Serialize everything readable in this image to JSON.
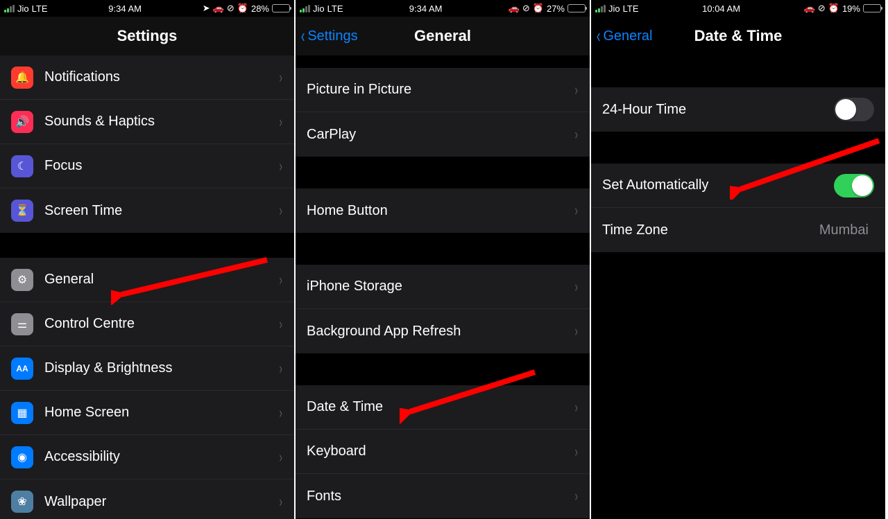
{
  "phone1": {
    "status": {
      "carrier": "Jio",
      "network": "LTE",
      "time": "9:34 AM",
      "battery_pct": "28%",
      "battery_level": 28
    },
    "nav": {
      "title": "Settings"
    },
    "group1": [
      {
        "name": "notifications",
        "label": "Notifications",
        "icon": "bell-icon",
        "icon_bg": "ic-red",
        "glyph": "🔔"
      },
      {
        "name": "sounds-haptics",
        "label": "Sounds & Haptics",
        "icon": "speaker-icon",
        "icon_bg": "ic-pink",
        "glyph": "🔊"
      },
      {
        "name": "focus",
        "label": "Focus",
        "icon": "moon-icon",
        "icon_bg": "ic-indigo",
        "glyph": "☾"
      },
      {
        "name": "screen-time",
        "label": "Screen Time",
        "icon": "hourglass-icon",
        "icon_bg": "ic-indigo",
        "glyph": "⏳"
      }
    ],
    "group2": [
      {
        "name": "general",
        "label": "General",
        "icon": "gear-icon",
        "icon_bg": "ic-gray",
        "glyph": "⚙"
      },
      {
        "name": "control-centre",
        "label": "Control Centre",
        "icon": "toggles-icon",
        "icon_bg": "ic-gray",
        "glyph": "⚌"
      },
      {
        "name": "display-brightness",
        "label": "Display & Brightness",
        "icon": "text-size-icon",
        "icon_bg": "ic-blue",
        "glyph": "AA"
      },
      {
        "name": "home-screen",
        "label": "Home Screen",
        "icon": "grid-icon",
        "icon_bg": "ic-blue",
        "glyph": "▦"
      },
      {
        "name": "accessibility",
        "label": "Accessibility",
        "icon": "person-icon",
        "icon_bg": "ic-blue",
        "glyph": "◉"
      },
      {
        "name": "wallpaper",
        "label": "Wallpaper",
        "icon": "flower-icon",
        "icon_bg": "ic-teal",
        "glyph": "❀"
      }
    ],
    "arrow_target": "general"
  },
  "phone2": {
    "status": {
      "carrier": "Jio",
      "network": "LTE",
      "time": "9:34 AM",
      "battery_pct": "27%",
      "battery_level": 27
    },
    "nav": {
      "back": "Settings",
      "title": "General"
    },
    "groups": [
      [
        {
          "name": "picture-in-picture",
          "label": "Picture in Picture"
        },
        {
          "name": "carplay",
          "label": "CarPlay"
        }
      ],
      [
        {
          "name": "home-button",
          "label": "Home Button"
        }
      ],
      [
        {
          "name": "iphone-storage",
          "label": "iPhone Storage"
        },
        {
          "name": "background-app-refresh",
          "label": "Background App Refresh"
        }
      ],
      [
        {
          "name": "date-time",
          "label": "Date & Time"
        },
        {
          "name": "keyboard",
          "label": "Keyboard"
        },
        {
          "name": "fonts",
          "label": "Fonts"
        }
      ]
    ],
    "arrow_target": "date-time"
  },
  "phone3": {
    "status": {
      "carrier": "Jio",
      "network": "LTE",
      "time": "10:04 AM",
      "battery_pct": "19%",
      "battery_level": 19,
      "battery_low": true
    },
    "nav": {
      "back": "General",
      "title": "Date & Time"
    },
    "rows": {
      "twentyfour": {
        "label": "24-Hour Time",
        "on": false
      },
      "set_auto": {
        "label": "Set Automatically",
        "on": true
      },
      "timezone": {
        "label": "Time Zone",
        "value": "Mumbai"
      }
    },
    "arrow_target": "set-automatically"
  }
}
